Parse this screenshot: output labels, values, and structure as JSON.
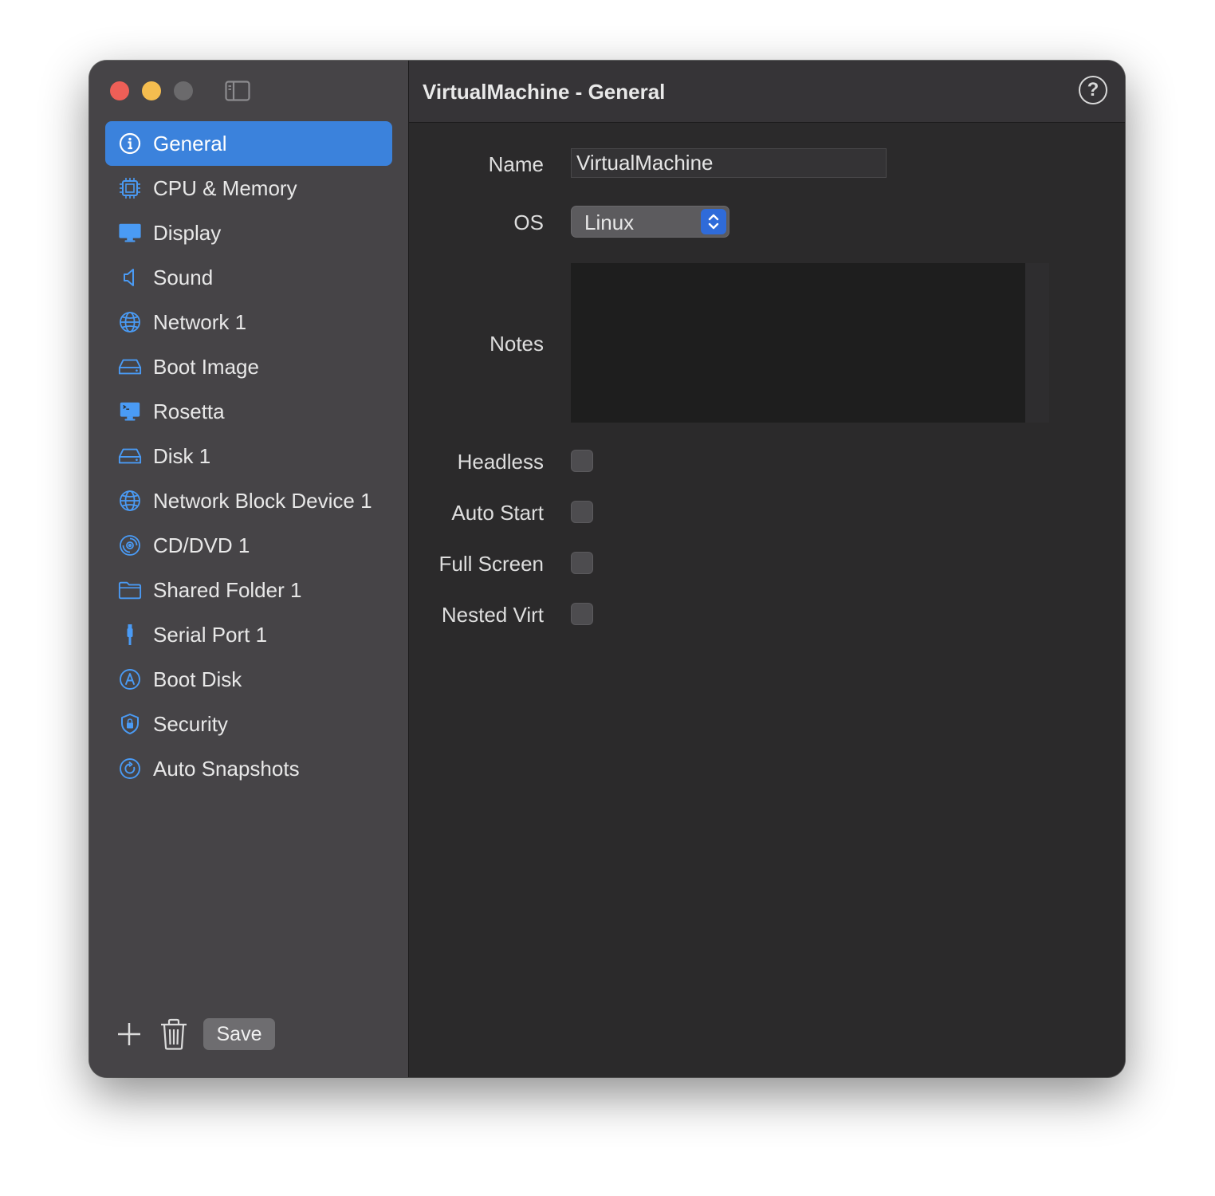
{
  "window": {
    "title": "VirtualMachine - General"
  },
  "sidebar": {
    "items": [
      {
        "label": "General",
        "icon": "info-icon",
        "selected": true
      },
      {
        "label": "CPU & Memory",
        "icon": "cpu-icon"
      },
      {
        "label": "Display",
        "icon": "display-icon"
      },
      {
        "label": "Sound",
        "icon": "speaker-icon"
      },
      {
        "label": "Network 1",
        "icon": "globe-icon"
      },
      {
        "label": "Boot Image",
        "icon": "drive-icon"
      },
      {
        "label": "Rosetta",
        "icon": "terminal-display-icon"
      },
      {
        "label": "Disk 1",
        "icon": "drive-icon"
      },
      {
        "label": "Network Block Device 1",
        "icon": "globe-icon"
      },
      {
        "label": "CD/DVD 1",
        "icon": "disc-icon"
      },
      {
        "label": "Shared Folder 1",
        "icon": "folder-icon"
      },
      {
        "label": "Serial Port 1",
        "icon": "cable-icon"
      },
      {
        "label": "Boot Disk",
        "icon": "app-store-icon"
      },
      {
        "label": "Security",
        "icon": "shield-lock-icon"
      },
      {
        "label": "Auto Snapshots",
        "icon": "clock-arrow-icon"
      }
    ],
    "save_label": "Save"
  },
  "form": {
    "name_label": "Name",
    "name_value": "VirtualMachine",
    "os_label": "OS",
    "os_value": "Linux",
    "notes_label": "Notes",
    "notes_value": "",
    "headless_label": "Headless",
    "headless_checked": false,
    "auto_start_label": "Auto Start",
    "auto_start_checked": false,
    "full_screen_label": "Full Screen",
    "full_screen_checked": false,
    "nested_virt_label": "Nested Virt",
    "nested_virt_checked": false
  },
  "colors": {
    "accent": "#3b82dc",
    "icon_blue": "#4a9bf5",
    "sidebar_bg": "#464447",
    "main_bg": "#2b2a2b"
  }
}
